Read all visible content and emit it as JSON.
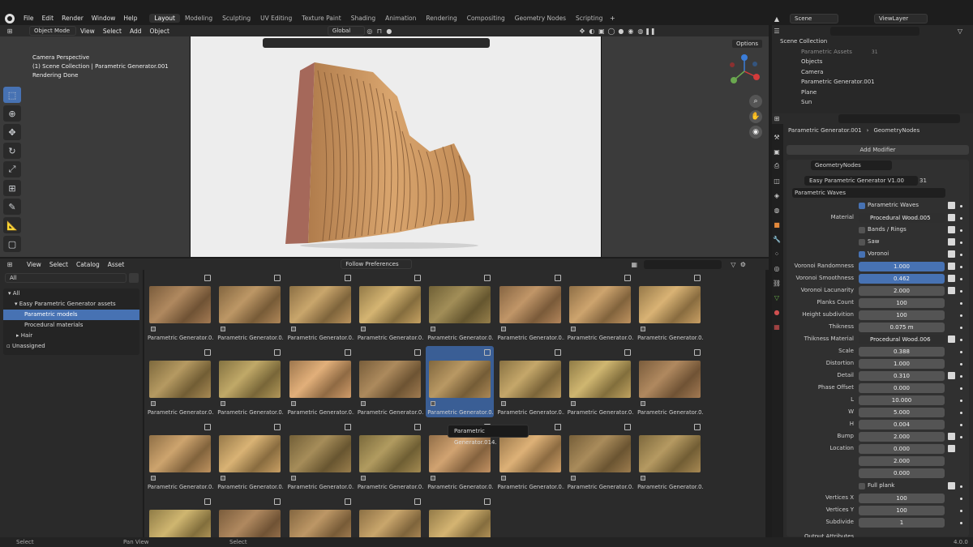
{
  "menu": [
    "File",
    "Edit",
    "Render",
    "Window",
    "Help"
  ],
  "workspaces": [
    "Layout",
    "Modeling",
    "Sculpting",
    "UV Editing",
    "Texture Paint",
    "Shading",
    "Animation",
    "Rendering",
    "Compositing",
    "Geometry Nodes",
    "Scripting"
  ],
  "active_workspace": "Layout",
  "scene": "Scene",
  "view_layer": "ViewLayer",
  "viewport": {
    "mode": "Object Mode",
    "menus": [
      "View",
      "Select",
      "Add",
      "Object"
    ],
    "transform": "Global",
    "options": "Options",
    "info": [
      "Camera Perspective",
      "(1) Scene Collection | Parametric Generator.001",
      "Rendering Done"
    ]
  },
  "asset_browser": {
    "menus": [
      "View",
      "Select",
      "Catalog",
      "Asset"
    ],
    "import": "Follow Preferences",
    "filter": "All",
    "tree": {
      "all": "All",
      "library": "Easy Parametric Generator assets",
      "items": [
        "Parametric models",
        "Procedural materials",
        "Hair"
      ],
      "unassigned": "Unassigned"
    },
    "caption": "Parametric Generator.0...",
    "tooltip": "Parametric Generator.014."
  },
  "outliner": {
    "title": "Scene Collection",
    "items": [
      {
        "name": "Parametric Assets",
        "badge": "31"
      },
      {
        "name": "Objects"
      },
      {
        "name": "Camera"
      },
      {
        "name": "Parametric Generator.001"
      },
      {
        "name": "Plane"
      },
      {
        "name": "Sun"
      }
    ]
  },
  "properties": {
    "object": "Parametric Generator.001",
    "modifier_path": "GeometryNodes",
    "add_modifier": "Add Modifier",
    "modifier_name": "GeometryNodes",
    "node_group": "Easy Parametric Generator V1.00",
    "users": "31",
    "section": "Parametric Waves",
    "checks": [
      {
        "label": "Parametric Waves",
        "on": true
      },
      {
        "label": "Bands / Rings",
        "on": false
      },
      {
        "label": "Saw",
        "on": false
      },
      {
        "label": "Voronoi",
        "on": true
      },
      {
        "label": "Full plank",
        "on": false
      }
    ],
    "material_label": "Material",
    "material": "Procedural Wood.005",
    "thickness_material_label": "Thikness Material",
    "thickness_material": "Procedural Wood.006",
    "fields": [
      {
        "label": "Voronoi Randomness",
        "value": "1.000"
      },
      {
        "label": "Voronoi Smoothness",
        "value": "0.462"
      },
      {
        "label": "Voronoi Lacunarity",
        "value": "2.000"
      },
      {
        "label": "Planks Count",
        "value": "100"
      },
      {
        "label": "Height subdivition",
        "value": "100"
      },
      {
        "label": "Thikness",
        "value": "0.075 m"
      }
    ],
    "fields2": [
      {
        "label": "Scale",
        "value": "0.388"
      },
      {
        "label": "Distortion",
        "value": "1.000"
      },
      {
        "label": "Detail",
        "value": "0.310"
      },
      {
        "label": "Phase Offset",
        "value": "0.000"
      },
      {
        "label": "L",
        "value": "10.000"
      },
      {
        "label": "W",
        "value": "5.000"
      },
      {
        "label": "H",
        "value": "0.004"
      },
      {
        "label": "Bump",
        "value": "2.000"
      }
    ],
    "location_label": "Location",
    "location": [
      "0.000",
      "2.000",
      "0.000"
    ],
    "fields3": [
      {
        "label": "Vertices X",
        "value": "100"
      },
      {
        "label": "Vertices Y",
        "value": "100"
      },
      {
        "label": "Subdivide",
        "value": "1"
      }
    ],
    "output": "Output Attributes"
  },
  "status": {
    "left": "Select",
    "mid": "Pan View",
    "right": "Select",
    "version": "4.0.0"
  }
}
